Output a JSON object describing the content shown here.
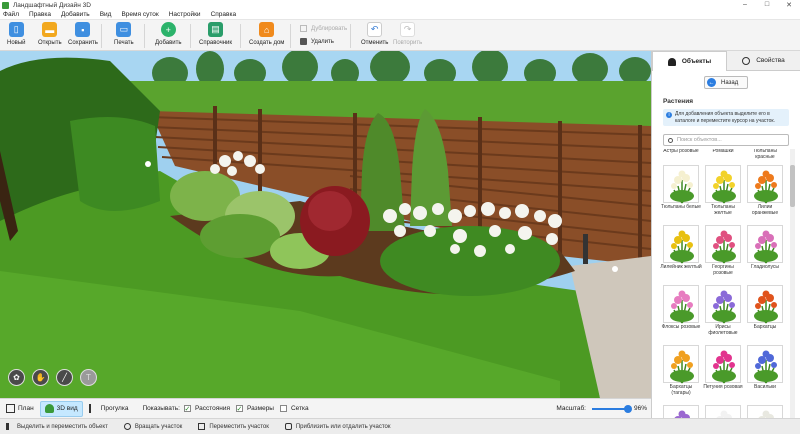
{
  "window": {
    "title": "Ландшафтный Дизайн 3D"
  },
  "menu": [
    "Файл",
    "Правка",
    "Добавить",
    "Вид",
    "Время суток",
    "Настройки",
    "Справка"
  ],
  "toolbar": {
    "new": "Новый",
    "open": "Открыть",
    "save": "Сохранить",
    "print": "Печать",
    "add": "Добавить",
    "help": "Справочник",
    "create_house": "Создать дом",
    "duplicate": "Дублировать",
    "delete": "Удалить",
    "undo": "Отменить",
    "redo": "Повторить"
  },
  "viewbar": {
    "plan": "План",
    "view3d": "3D вид",
    "walk": "Прогулка",
    "show_label": "Показывать:",
    "distances": "Расстояния",
    "sizes": "Размеры",
    "grid": "Сетка",
    "distances_checked": true,
    "sizes_checked": true,
    "grid_checked": false,
    "zoom_label": "Масштаб:",
    "zoom_value": "96%",
    "zoom_fraction": 0.96
  },
  "statusbar": [
    "Выделить и переместить объект",
    "Вращать участок",
    "Переместить участок",
    "Приблизить или отдалить участок"
  ],
  "panel": {
    "tab_objects": "Объекты",
    "tab_properties": "Свойства",
    "back": "Назад",
    "section": "Растения",
    "info": "Для добавления объекта выделите его в каталоге и переместите курсор на участок.",
    "search_placeholder": "Поиск объектов...",
    "top_labels": [
      "Астры розовые",
      "Ромашки",
      "Тюльпаны красные"
    ],
    "items": [
      {
        "label": "Тюльпаны белые",
        "flower": "#f5f0d0"
      },
      {
        "label": "Тюльпаны желтые",
        "flower": "#f2d22a"
      },
      {
        "label": "Лилии оранжевые",
        "flower": "#ee7a1c"
      },
      {
        "label": "Лилейник желтый",
        "flower": "#e8c010"
      },
      {
        "label": "Георгины розовые",
        "flower": "#e05080"
      },
      {
        "label": "Гладиолусы",
        "flower": "#d96fb8"
      },
      {
        "label": "Флоксы розовые",
        "flower": "#e77cc0"
      },
      {
        "label": "Ирисы фиолетовые",
        "flower": "#8a6ad8"
      },
      {
        "label": "Бархатцы",
        "flower": "#e0531c"
      },
      {
        "label": "Бархатцы (тагары)",
        "flower": "#f0a020"
      },
      {
        "label": "Петуния розовая",
        "flower": "#e2348e"
      },
      {
        "label": "Васильки",
        "flower": "#5068d8"
      },
      {
        "label": "",
        "flower": "#9a68d0"
      },
      {
        "label": "",
        "flower": "#f2f2f2"
      },
      {
        "label": "",
        "flower": "#e8e8e0"
      }
    ]
  }
}
